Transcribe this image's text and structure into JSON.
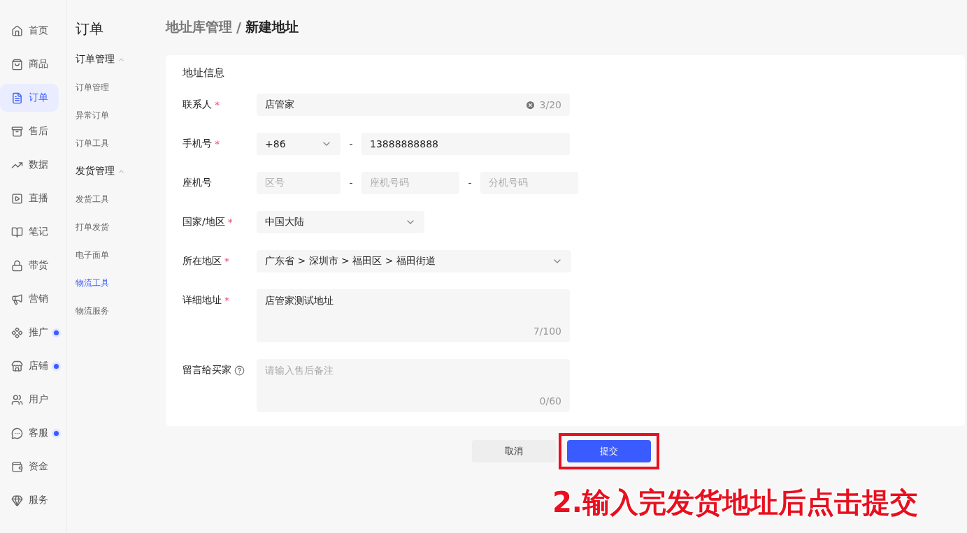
{
  "nav": {
    "items": [
      {
        "label": "首页",
        "selected": false,
        "dot": false
      },
      {
        "label": "商品",
        "selected": false,
        "dot": false
      },
      {
        "label": "订单",
        "selected": true,
        "dot": false
      },
      {
        "label": "售后",
        "selected": false,
        "dot": false
      },
      {
        "label": "数据",
        "selected": false,
        "dot": false
      },
      {
        "label": "直播",
        "selected": false,
        "dot": false
      },
      {
        "label": "笔记",
        "selected": false,
        "dot": false
      },
      {
        "label": "带货",
        "selected": false,
        "dot": false
      },
      {
        "label": "营销",
        "selected": false,
        "dot": false
      },
      {
        "label": "推广",
        "selected": false,
        "dot": true
      },
      {
        "label": "店铺",
        "selected": false,
        "dot": true
      },
      {
        "label": "用户",
        "selected": false,
        "dot": false
      },
      {
        "label": "客服",
        "selected": false,
        "dot": true
      },
      {
        "label": "资金",
        "selected": false,
        "dot": false
      },
      {
        "label": "服务",
        "selected": false,
        "dot": false
      }
    ]
  },
  "subnav": {
    "title": "订单",
    "groups": [
      {
        "label": "订单管理",
        "expanded": true,
        "items": [
          {
            "label": "订单管理",
            "selected": false
          },
          {
            "label": "异常订单",
            "selected": false
          },
          {
            "label": "订单工具",
            "selected": false
          }
        ]
      },
      {
        "label": "发货管理",
        "expanded": true,
        "items": [
          {
            "label": "发货工具",
            "selected": false
          },
          {
            "label": "打单发货",
            "selected": false
          },
          {
            "label": "电子面单",
            "selected": false
          },
          {
            "label": "物流工具",
            "selected": true
          },
          {
            "label": "物流服务",
            "selected": false
          }
        ]
      }
    ]
  },
  "breadcrumb": {
    "parent": "地址库管理",
    "separator": "/",
    "current": "新建地址"
  },
  "form": {
    "section_title": "地址信息",
    "fields": [
      {
        "kind": "text",
        "label": "联系人",
        "required_mark": "*",
        "value": "店管家",
        "counter": "3/20"
      },
      {
        "kind": "phone",
        "label": "手机号",
        "required_mark": "*",
        "code": "+86",
        "separator": "-",
        "value": "13888888888"
      },
      {
        "kind": "landline",
        "label": "座机号",
        "separator": "-",
        "placeholders": [
          "区号",
          "座机号码",
          "分机号码"
        ]
      },
      {
        "kind": "select",
        "label": "国家/地区",
        "required_mark": "*",
        "value": "中国大陆"
      },
      {
        "kind": "region",
        "label": "所在地区",
        "required_mark": "*",
        "value": "广东省 > 深圳市 > 福田区 > 福田街道"
      },
      {
        "kind": "textarea",
        "label": "详细地址",
        "required_mark": "*",
        "value": "店管家测试地址",
        "counter": "7/100"
      },
      {
        "kind": "textarea",
        "label": "留言给买家",
        "help": true,
        "placeholder": "请输入售后备注",
        "counter": "0/60"
      }
    ]
  },
  "actions": {
    "cancel": "取消",
    "submit": "提交"
  },
  "annotation": {
    "text": "2.输入完发货地址后点击提交",
    "highlight": true
  }
}
